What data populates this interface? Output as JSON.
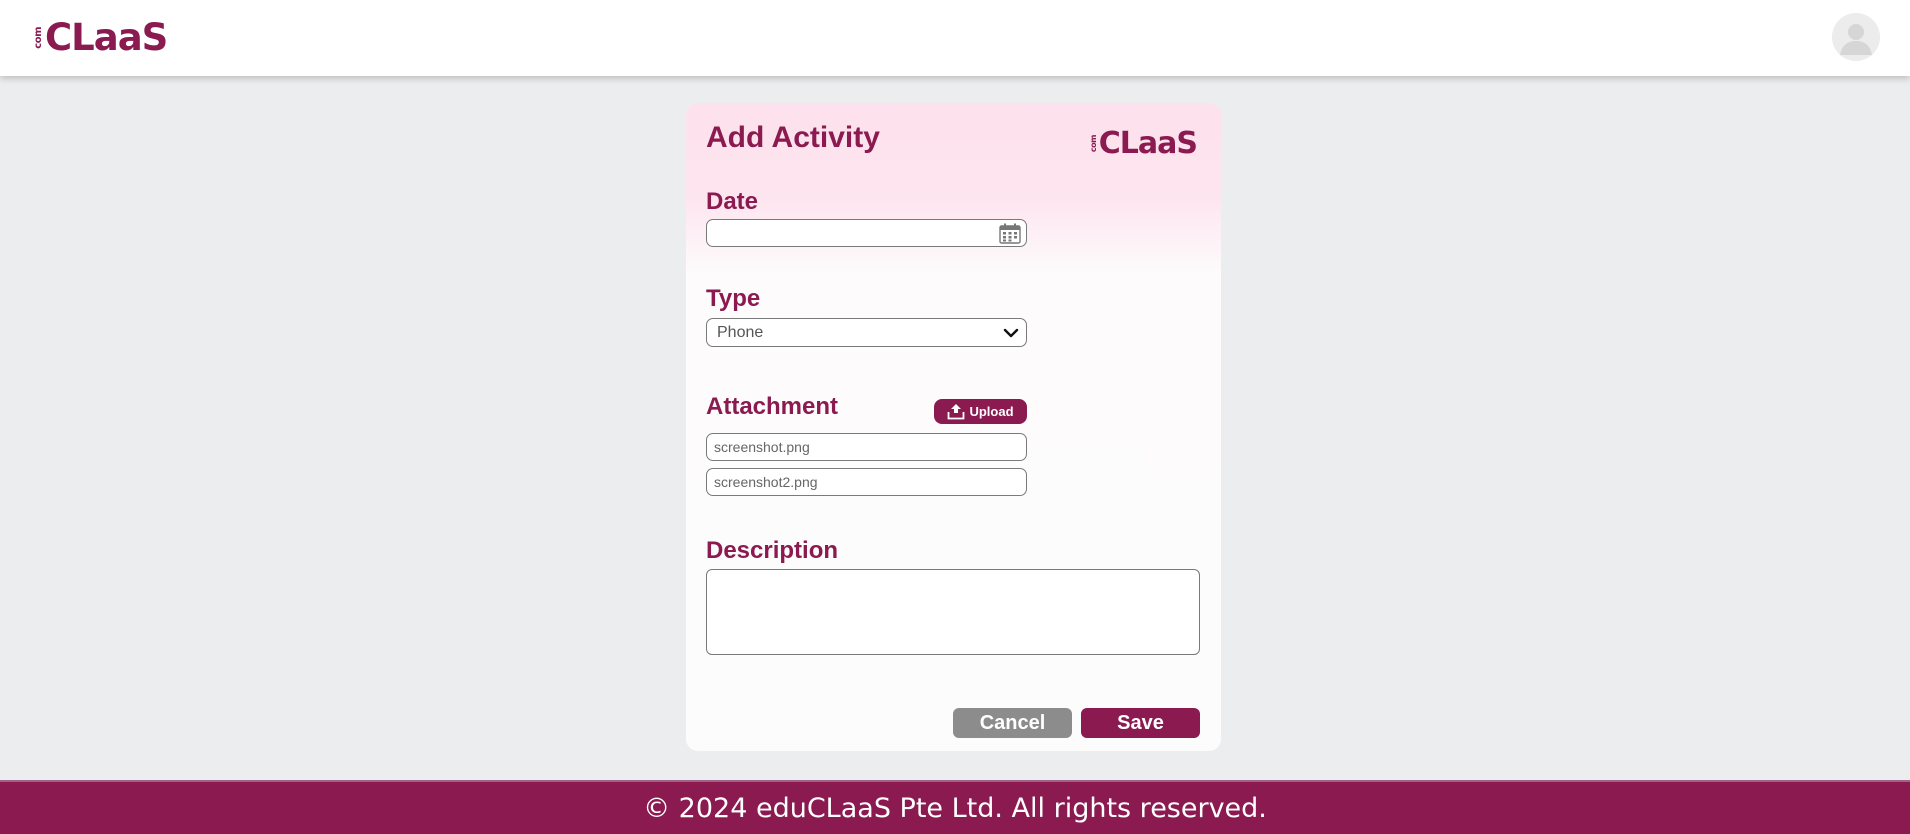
{
  "header": {
    "logo": {
      "prefix": "com",
      "wordmark": "CLaaS"
    },
    "avatar_icon": "user-avatar-icon"
  },
  "form": {
    "title": "Add Activity",
    "logo": {
      "prefix": "com",
      "wordmark": "CLaaS"
    },
    "date": {
      "label": "Date",
      "value": "",
      "icon": "calendar-icon"
    },
    "type": {
      "label": "Type",
      "selected": "Phone",
      "icon": "chevron-down-icon"
    },
    "attachment": {
      "label": "Attachment",
      "upload_label": "Upload",
      "files": [
        "screenshot.png",
        "screenshot2.png"
      ]
    },
    "description": {
      "label": "Description",
      "value": ""
    },
    "cancel_label": "Cancel",
    "save_label": "Save"
  },
  "footer": {
    "text": "© 2024 eduCLaaS Pte Ltd. All rights reserved."
  },
  "colors": {
    "brand": "#8a1a4f",
    "background": "#ecedef",
    "cancel": "#8c8c8c",
    "card_gradient_top": "#fde1ee"
  }
}
